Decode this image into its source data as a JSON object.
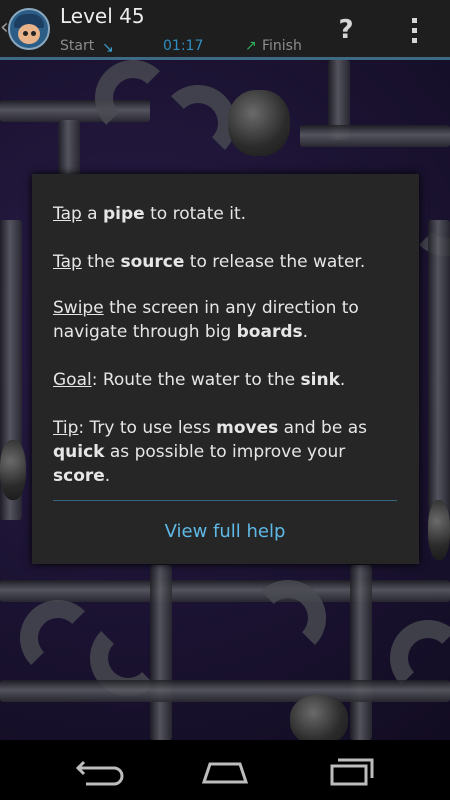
{
  "header": {
    "level_title": "Level 45",
    "start_label": "Start",
    "timer": "01:17",
    "finish_label": "Finish",
    "help_symbol": "?"
  },
  "help_dialog": {
    "tip1": {
      "action": "Tap",
      "t1": " a ",
      "b1": "pipe",
      "t2": " to rotate it."
    },
    "tip2": {
      "action": "Tap",
      "t1": " the ",
      "b1": "source",
      "t2": " to release the water."
    },
    "tip3": {
      "action": "Swipe",
      "t1": " the screen in any direction to navigate through big ",
      "b1": "boards",
      "t2": "."
    },
    "tip4": {
      "action": "Goal",
      "t1": ": Route the water to the ",
      "b1": "sink",
      "t2": "."
    },
    "tip5": {
      "action": "Tip",
      "t1": ": Try to use less ",
      "b1": "moves",
      "t2": " and be as ",
      "b2": "quick",
      "t3": " as possible to improve your ",
      "b3": "score",
      "t4": "."
    },
    "view_full_help": "View full help"
  },
  "colors": {
    "accent": "#5fb9e6",
    "timer": "#2e8fbf",
    "finish_arrow": "#2fae5a",
    "start_arrow": "#3ea0d0"
  },
  "icons": {
    "back": "back-icon",
    "home": "home-icon",
    "recents": "recents-icon",
    "overflow": "overflow-menu-icon"
  }
}
